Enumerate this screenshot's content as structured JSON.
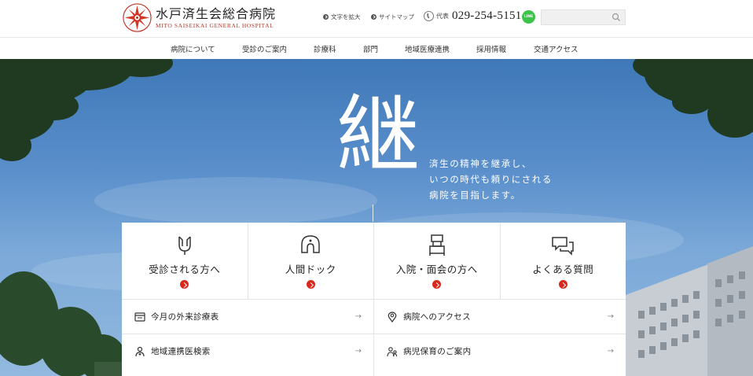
{
  "header": {
    "logo_title": "水戸済生会総合病院",
    "logo_subtitle": "MITO SAISEIKAI GENERAL HOSPITAL",
    "text_size_label": "文字を拡大",
    "sitemap_label": "サイトマップ",
    "phone_label": "代表",
    "phone_number": "029-254-5151",
    "line_label": "LINE",
    "search_placeholder": ""
  },
  "nav": {
    "items": [
      {
        "label": "病院について"
      },
      {
        "label": "受診のご案内"
      },
      {
        "label": "診療科"
      },
      {
        "label": "部門"
      },
      {
        "label": "地域医療連携"
      },
      {
        "label": "採用情報"
      },
      {
        "label": "交通アクセス"
      }
    ]
  },
  "hero": {
    "kanji": "継",
    "message_lines": [
      "済生の精神を継承し、",
      "いつの時代も頼りにされる",
      "病院を目指します。"
    ]
  },
  "cards": [
    {
      "label": "受診される方へ",
      "icon": "stethoscope-icon"
    },
    {
      "label": "人間ドック",
      "icon": "checkup-icon"
    },
    {
      "label": "入院・面会の方へ",
      "icon": "bed-icon"
    },
    {
      "label": "よくある質問",
      "icon": "chat-bubbles-icon"
    }
  ],
  "links": [
    {
      "label": "今月の外来診療表",
      "icon": "calendar-icon"
    },
    {
      "label": "病院へのアクセス",
      "icon": "map-pin-icon"
    },
    {
      "label": "地域連携医検索",
      "icon": "doctor-search-icon"
    },
    {
      "label": "病児保育のご案内",
      "icon": "childcare-icon"
    }
  ],
  "colors": {
    "accent": "#d9281c",
    "line_green": "#3cc44a",
    "sky": "#5a8fcb"
  }
}
